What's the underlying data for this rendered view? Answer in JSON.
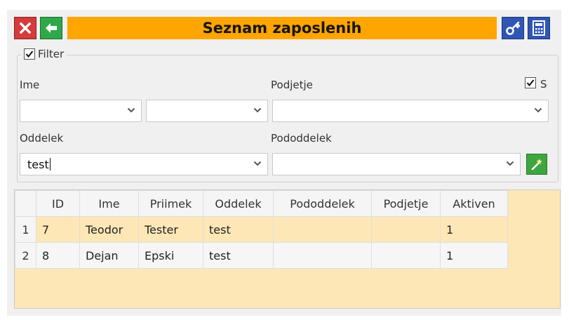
{
  "header": {
    "title": "Seznam zaposlenih",
    "close_icon": "close-icon",
    "back_icon": "arrow-left-icon",
    "key_icon": "key-icon",
    "calc_icon": "calculator-icon"
  },
  "filter": {
    "label": "Filter",
    "checked": true,
    "ime_label": "Ime",
    "ime_value_1": "",
    "ime_value_2": "",
    "podjetje_label": "Podjetje",
    "podjetje_value": "",
    "s_label": "S",
    "s_checked": true,
    "oddelek_label": "Oddelek",
    "oddelek_value": "test",
    "pododdelek_label": "Pododdelek",
    "pododdelek_value": "",
    "wand_icon": "magic-wand-icon"
  },
  "table": {
    "columns": [
      "ID",
      "Ime",
      "Priimek",
      "Oddelek",
      "Pododdelek",
      "Podjetje",
      "Aktiven"
    ],
    "rows": [
      {
        "num": "1",
        "cells": [
          "7",
          "Teodor",
          "Tester",
          "test",
          "",
          "",
          "1"
        ]
      },
      {
        "num": "2",
        "cells": [
          "8",
          "Dejan",
          "Epski",
          "test",
          "",
          "",
          "1"
        ]
      }
    ]
  },
  "colors": {
    "title_bar": "#ffa500",
    "grid_background": "#fde7b6",
    "close_button": "#d63b3b",
    "back_button": "#2fa84a",
    "tool_button": "#2f55b5"
  }
}
